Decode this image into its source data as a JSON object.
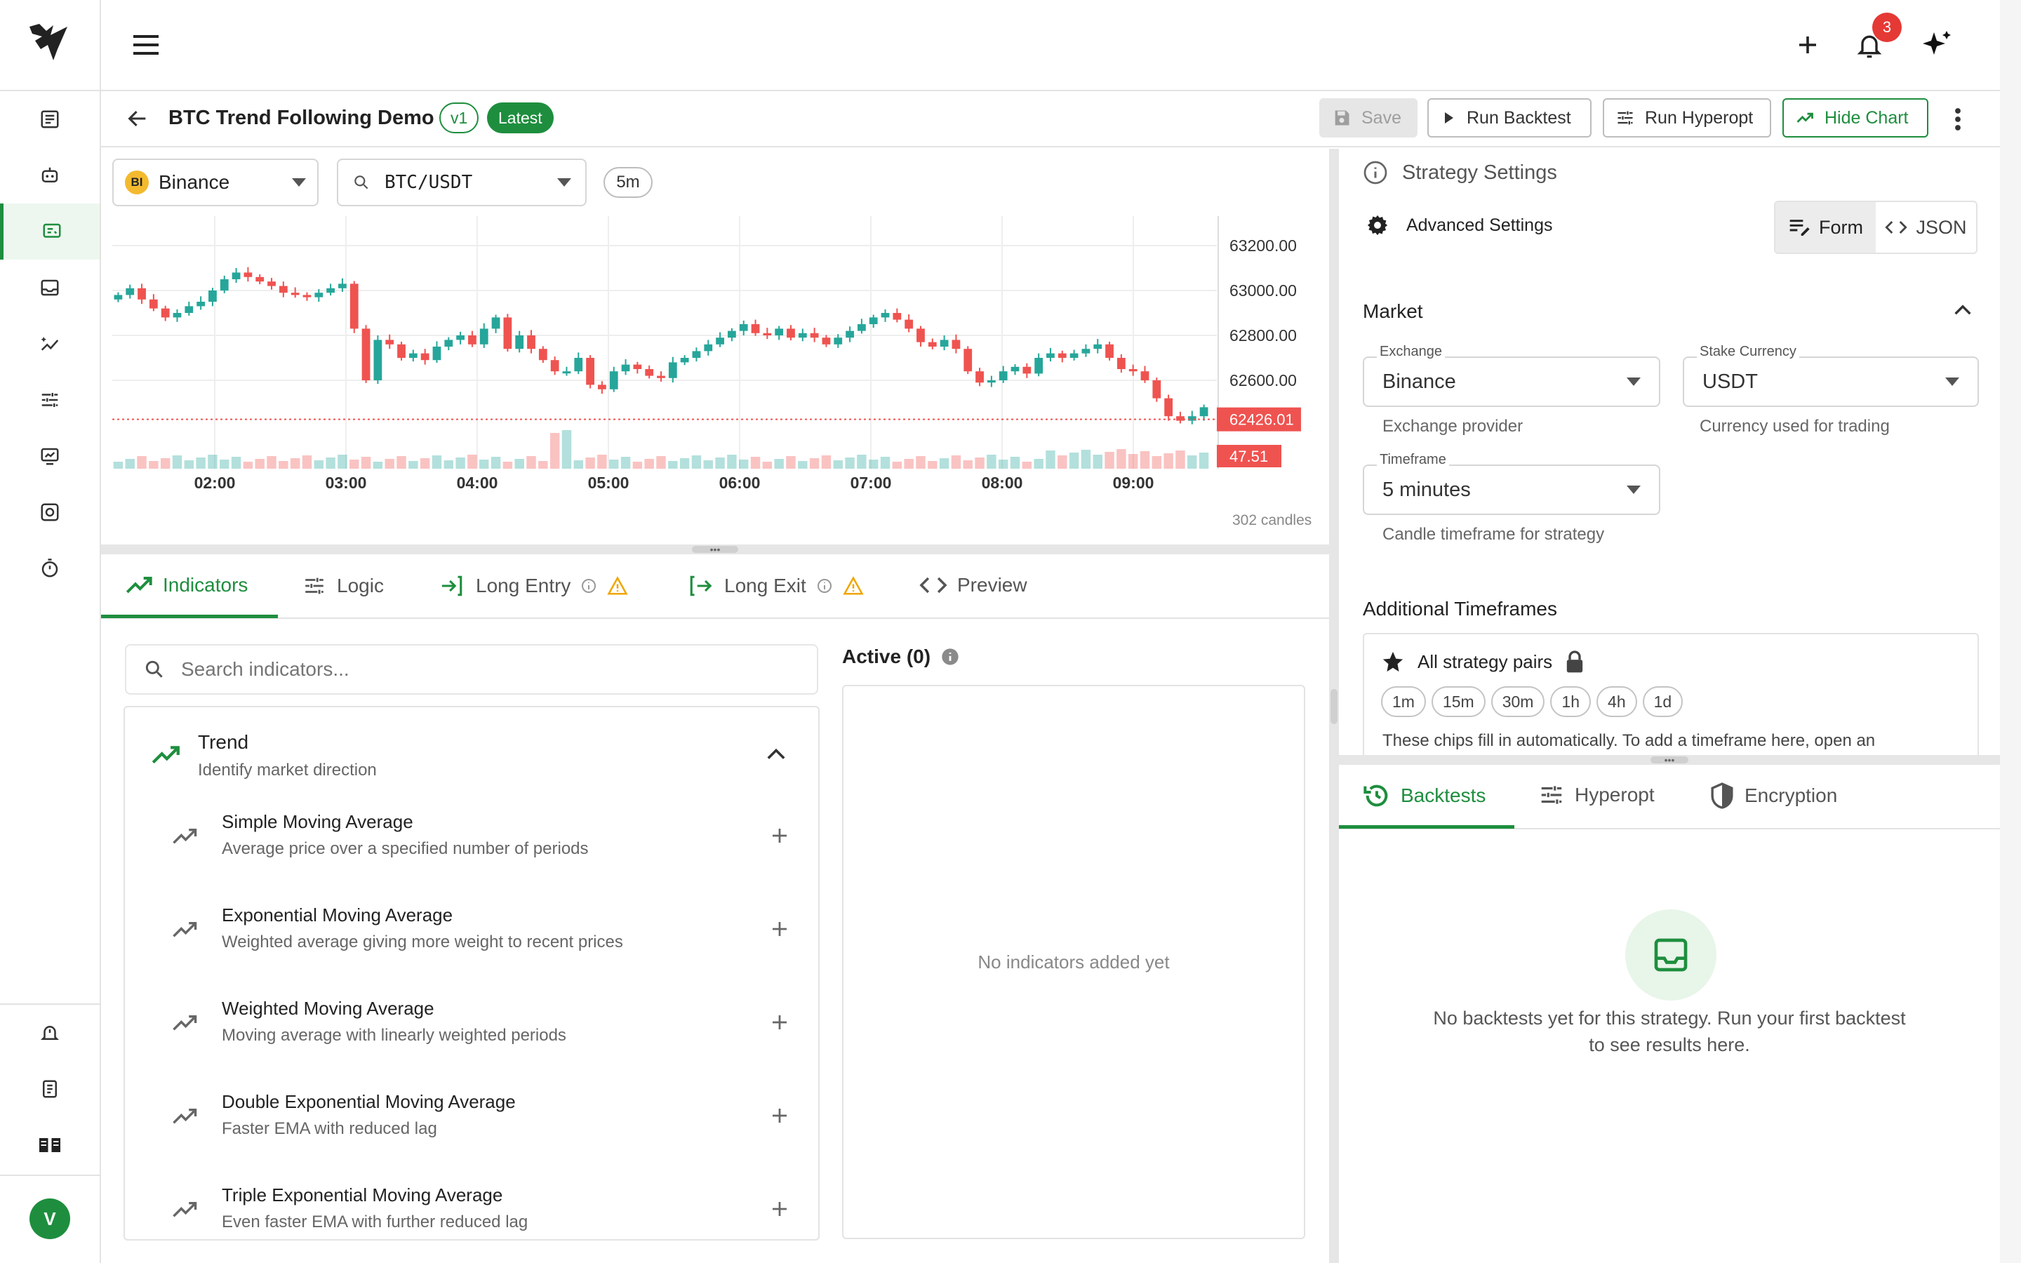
{
  "topbar": {
    "notification_count": "3"
  },
  "header": {
    "title": "BTC Trend Following Demo",
    "version": "v1",
    "latest_badge": "Latest",
    "save_label": "Save",
    "run_backtest_label": "Run Backtest",
    "run_hyperopt_label": "Run Hyperopt",
    "hide_chart_label": "Hide Chart"
  },
  "chart_toolbar": {
    "exchange_badge": "BI",
    "exchange": "Binance",
    "pair": "BTC/USDT",
    "timeframe": "5m"
  },
  "chart_data": {
    "type": "candlestick",
    "y_ticks": [
      "63200.00",
      "63000.00",
      "62800.00",
      "62600.00"
    ],
    "x_ticks": [
      "02:00",
      "03:00",
      "04:00",
      "05:00",
      "06:00",
      "07:00",
      "08:00",
      "09:00"
    ],
    "last_price": "62426.01",
    "last_volume": "47.51",
    "candle_count": "302 candles",
    "closes": [
      62980,
      63010,
      62960,
      62920,
      62880,
      62900,
      62930,
      62950,
      63000,
      63050,
      63080,
      63060,
      63040,
      63020,
      62990,
      62980,
      62970,
      62990,
      63010,
      63030,
      62830,
      62600,
      62780,
      62760,
      62700,
      62720,
      62690,
      62750,
      62780,
      62800,
      62760,
      62830,
      62880,
      62740,
      62800,
      62740,
      62690,
      62640,
      62640,
      62700,
      62580,
      62560,
      62640,
      62670,
      62650,
      62620,
      62610,
      62680,
      62700,
      62730,
      62760,
      62790,
      62820,
      62850,
      62810,
      62800,
      62830,
      62790,
      62810,
      62790,
      62760,
      62790,
      62820,
      62850,
      62880,
      62900,
      62870,
      62830,
      62770,
      62750,
      62780,
      62740,
      62640,
      62590,
      62600,
      62640,
      62660,
      62630,
      62700,
      62720,
      62700,
      62720,
      62740,
      62760,
      62700,
      62650,
      62640,
      62600,
      62520,
      62440,
      62420,
      62440,
      62480
    ]
  },
  "bottom_tabs": {
    "indicators": "Indicators",
    "logic": "Logic",
    "long_entry": "Long Entry",
    "long_exit": "Long Exit",
    "preview": "Preview"
  },
  "indicators": {
    "search_placeholder": "Search indicators...",
    "group_title": "Trend",
    "group_subtitle": "Identify market direction",
    "items": [
      {
        "title": "Simple Moving Average",
        "desc": "Average price over a specified number of periods"
      },
      {
        "title": "Exponential Moving Average",
        "desc": "Weighted average giving more weight to recent prices"
      },
      {
        "title": "Weighted Moving Average",
        "desc": "Moving average with linearly weighted periods"
      },
      {
        "title": "Double Exponential Moving Average",
        "desc": "Faster EMA with reduced lag"
      },
      {
        "title": "Triple Exponential Moving Average",
        "desc": "Even faster EMA with further reduced lag"
      }
    ],
    "active_title": "Active (0)",
    "empty_text": "No indicators added yet"
  },
  "settings": {
    "title": "Strategy Settings",
    "advanced": "Advanced Settings",
    "form_label": "Form",
    "json_label": "JSON",
    "market_title": "Market",
    "exchange_label": "Exchange",
    "exchange_value": "Binance",
    "exchange_helper": "Exchange provider",
    "stake_label": "Stake Currency",
    "stake_value": "USDT",
    "stake_helper": "Currency used for trading",
    "timeframe_label": "Timeframe",
    "timeframe_value": "5 minutes",
    "timeframe_helper": "Candle timeframe for strategy",
    "additional_title": "Additional Timeframes",
    "all_pairs": "All strategy pairs",
    "timeframes": [
      "1m",
      "15m",
      "30m",
      "1h",
      "4h",
      "1d"
    ],
    "note": "These chips fill in automatically. To add a timeframe here, open an"
  },
  "results_tabs": {
    "backtests": "Backtests",
    "hyperopt": "Hyperopt",
    "encryption": "Encryption",
    "empty_line1": "No backtests yet for this strategy. Run your first backtest",
    "empty_line2": "to see results here."
  },
  "user": {
    "initial": "V"
  },
  "colors": {
    "accent": "#1e8e3e",
    "up": "#26a69a",
    "down": "#ef5350",
    "badge": "#e53935"
  }
}
